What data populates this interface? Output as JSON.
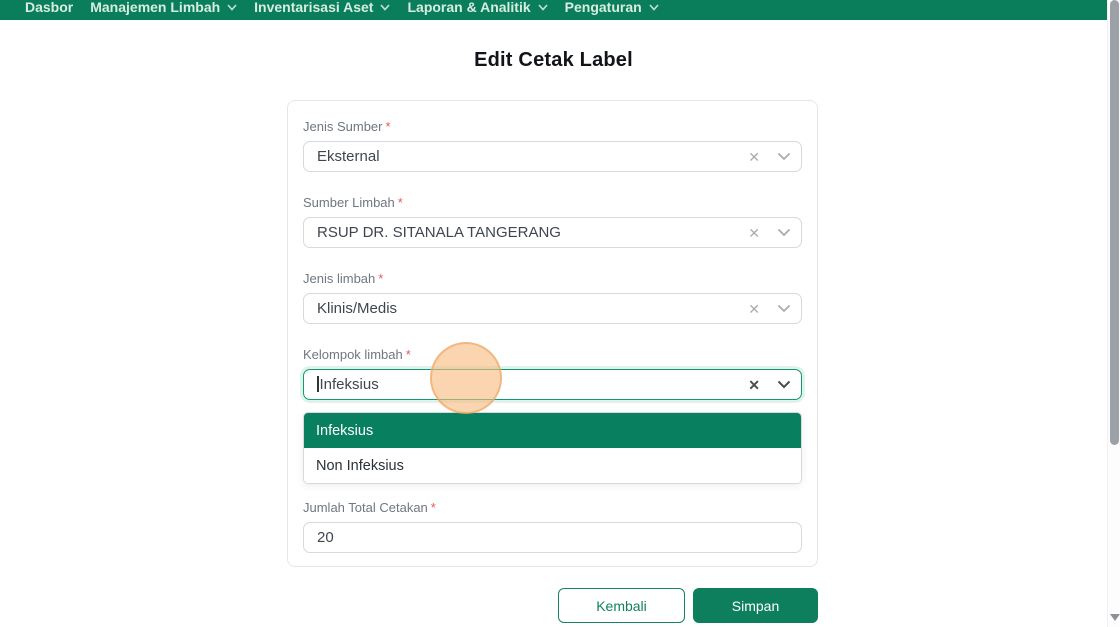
{
  "colors": {
    "nav_green": "#0a7e5b",
    "selected_option_green": "#088060",
    "save_button_green": "#0e7f5c",
    "required_red": "#e25c5c",
    "focus_border_green": "#129a6e"
  },
  "nav": {
    "items": [
      {
        "label": "Dasbor",
        "has_dropdown": false
      },
      {
        "label": "Manajemen Limbah",
        "has_dropdown": true
      },
      {
        "label": "Inventarisasi Aset",
        "has_dropdown": true
      },
      {
        "label": "Laporan & Analitik",
        "has_dropdown": true
      },
      {
        "label": "Pengaturan",
        "has_dropdown": true
      }
    ]
  },
  "page": {
    "title": "Edit Cetak Label"
  },
  "form": {
    "required_marker": "*",
    "fields": [
      {
        "label": "Jenis Sumber",
        "value": "Eksternal",
        "type": "select"
      },
      {
        "label": "Sumber Limbah",
        "value": "RSUP DR. SITANALA TANGERANG",
        "type": "select"
      },
      {
        "label": "Jenis limbah",
        "value": "Klinis/Medis",
        "type": "select"
      },
      {
        "label": "Kelompok limbah",
        "value": "Infeksius",
        "type": "select",
        "focused": true
      },
      {
        "label": "Jumlah Total Cetakan",
        "value": "20",
        "type": "text"
      }
    ],
    "dropdown": {
      "options": [
        {
          "label": "Infeksius",
          "selected": true
        },
        {
          "label": "Non Infeksius",
          "selected": false
        }
      ]
    }
  },
  "buttons": {
    "back": "Kembali",
    "save": "Simpan"
  },
  "icons": {
    "clear": "✕"
  }
}
